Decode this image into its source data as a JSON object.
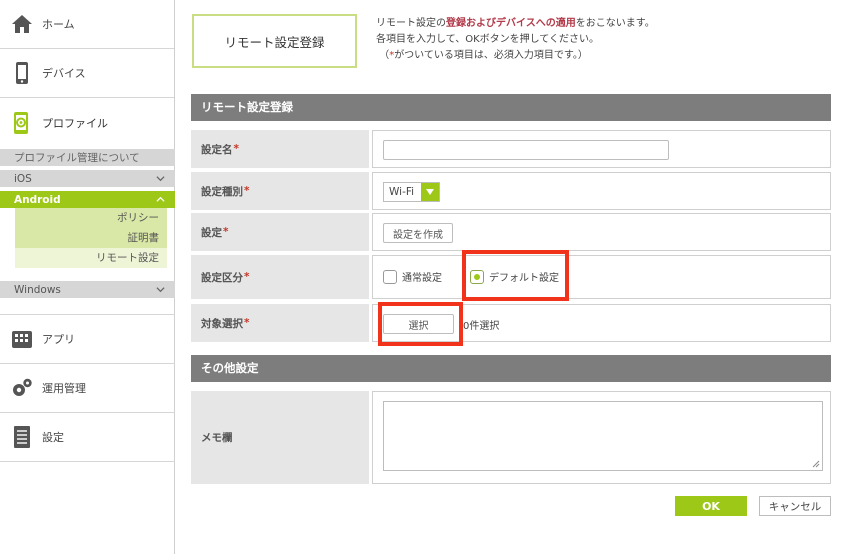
{
  "sidebar": {
    "nav": {
      "home": "ホーム",
      "devices": "デバイス",
      "profile": "プロファイル",
      "apps": "アプリ",
      "operations": "運用管理",
      "settings": "設定"
    },
    "profile_about": "プロファイル管理について",
    "os": {
      "ios": "iOS",
      "android": "Android",
      "windows": "Windows"
    },
    "android_sub": [
      "ポリシー",
      "証明書",
      "リモート設定"
    ]
  },
  "page_title": "リモート設定登録",
  "intro": {
    "line1_pre": "リモート設定の",
    "line1_em": "登録およびデバイスへの適用",
    "line1_post": "をおこないます。",
    "line2": "各項目を入力して、OKボタンを押してください。",
    "line3_pre": "（",
    "line3_req": "*",
    "line3_post": "がついている項目は、必須入力項目です。）"
  },
  "section1": {
    "title": "リモート設定登録",
    "fields": {
      "name_label": "設定名",
      "type_label": "設定種別",
      "type_value": "Wi-Fi",
      "setting_label": "設定",
      "setting_button": "設定を作成",
      "category_label": "設定区分",
      "category_opt1": "通常設定",
      "category_opt2": "デフォルト設定",
      "target_label": "対象選択",
      "target_button": "選択",
      "target_count": "0件選択"
    },
    "required_mark": "*"
  },
  "section2": {
    "title": "その他設定",
    "memo_label": "メモ欄",
    "memo_value": ""
  },
  "buttons": {
    "ok": "OK",
    "cancel": "キャンセル"
  },
  "colors": {
    "accent": "#9ec817",
    "highlight": "#f0331a",
    "section_header": "#7d7d7d"
  }
}
